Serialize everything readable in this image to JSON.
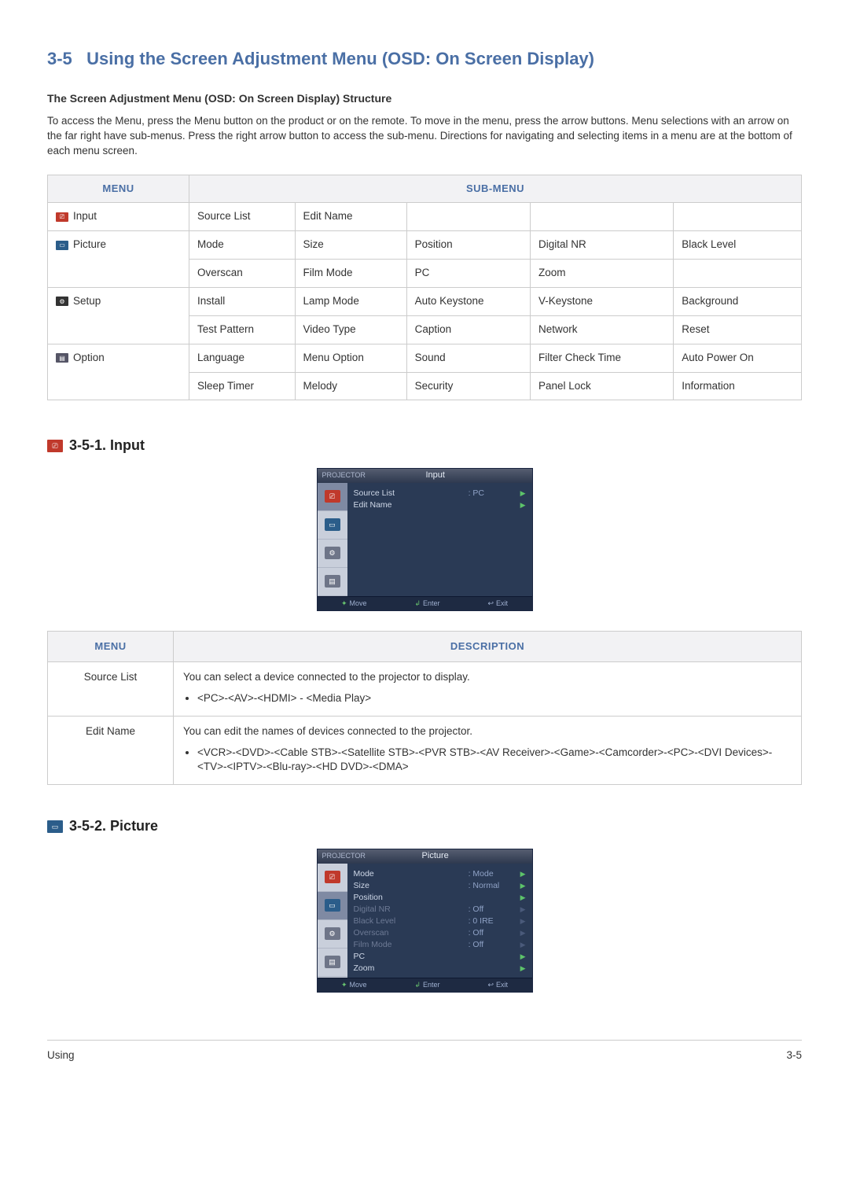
{
  "page": {
    "sectionNumber": "3-5",
    "title": "Using the Screen Adjustment Menu (OSD: On Screen Display)",
    "subtitle": "The Screen Adjustment Menu (OSD: On Screen Display) Structure",
    "intro": "To access the Menu, press the Menu button on the product or on the remote. To move in the menu, press the arrow buttons. Menu selections with an arrow on the far right have sub-menus. Press the right arrow button to access the sub-menu. Directions for navigating and selecting items in a menu are at the bottom of each menu screen."
  },
  "structureTable": {
    "headers": {
      "menu": "MENU",
      "submenu": "SUB-MENU"
    },
    "rows": [
      {
        "menu": "Input",
        "icon": "input",
        "cells": [
          [
            "Source List",
            "Edit Name",
            "",
            "",
            ""
          ]
        ]
      },
      {
        "menu": "Picture",
        "icon": "picture",
        "cells": [
          [
            "Mode",
            "Size",
            "Position",
            "Digital NR",
            "Black Level"
          ],
          [
            "Overscan",
            "Film Mode",
            "PC",
            "Zoom",
            ""
          ]
        ]
      },
      {
        "menu": "Setup",
        "icon": "setup",
        "cells": [
          [
            "Install",
            "Lamp Mode",
            "Auto Keystone",
            "V-Keystone",
            "Background"
          ],
          [
            "Test Pattern",
            "Video Type",
            "Caption",
            "Network",
            "Reset"
          ]
        ]
      },
      {
        "menu": "Option",
        "icon": "option",
        "cells": [
          [
            "Language",
            "Menu Option",
            "Sound",
            "Filter Check Time",
            "Auto Power On"
          ],
          [
            "Sleep Timer",
            "Melody",
            "Security",
            "Panel Lock",
            "Information"
          ]
        ]
      }
    ]
  },
  "sections": {
    "input": {
      "number": "3-5-1.",
      "name": "Input"
    },
    "picture": {
      "number": "3-5-2.",
      "name": "Picture"
    }
  },
  "osdInput": {
    "brand": "PROJECTOR",
    "title": "Input",
    "rows": [
      {
        "label": "Source List",
        "value": ": PC"
      },
      {
        "label": "Edit Name",
        "value": ""
      }
    ],
    "footer": {
      "move": "Move",
      "enter": "Enter",
      "exit": "Exit"
    }
  },
  "osdPicture": {
    "brand": "PROJECTOR",
    "title": "Picture",
    "rows": [
      {
        "label": "Mode",
        "value": ": Mode",
        "dim": false
      },
      {
        "label": "Size",
        "value": ": Normal",
        "dim": false
      },
      {
        "label": "Position",
        "value": "",
        "dim": false
      },
      {
        "label": "Digital NR",
        "value": ": Off",
        "dim": true
      },
      {
        "label": "Black Level",
        "value": ": 0 IRE",
        "dim": true
      },
      {
        "label": "Overscan",
        "value": ": Off",
        "dim": true
      },
      {
        "label": "Film Mode",
        "value": ": Off",
        "dim": true
      },
      {
        "label": "PC",
        "value": "",
        "dim": false
      },
      {
        "label": "Zoom",
        "value": "",
        "dim": false
      }
    ],
    "footer": {
      "move": "Move",
      "enter": "Enter",
      "exit": "Exit"
    }
  },
  "descTable": {
    "headers": {
      "menu": "MENU",
      "description": "DESCRIPTION"
    },
    "rows": [
      {
        "menu": "Source List",
        "desc": "You can select a device connected to the projector to display.",
        "bullet": "<PC>-<AV>-<HDMI> - <Media Play>"
      },
      {
        "menu": "Edit Name",
        "desc": "You can edit the names of devices connected to the projector.",
        "bullet": "<VCR>-<DVD>-<Cable STB>-<Satellite STB>-<PVR STB>-<AV Receiver>-<Game>-<Camcorder>-<PC>-<DVI Devices>-<TV>-<IPTV>-<Blu-ray>-<HD DVD>-<DMA>"
      }
    ]
  },
  "footer": {
    "left": "Using",
    "right": "3-5"
  }
}
